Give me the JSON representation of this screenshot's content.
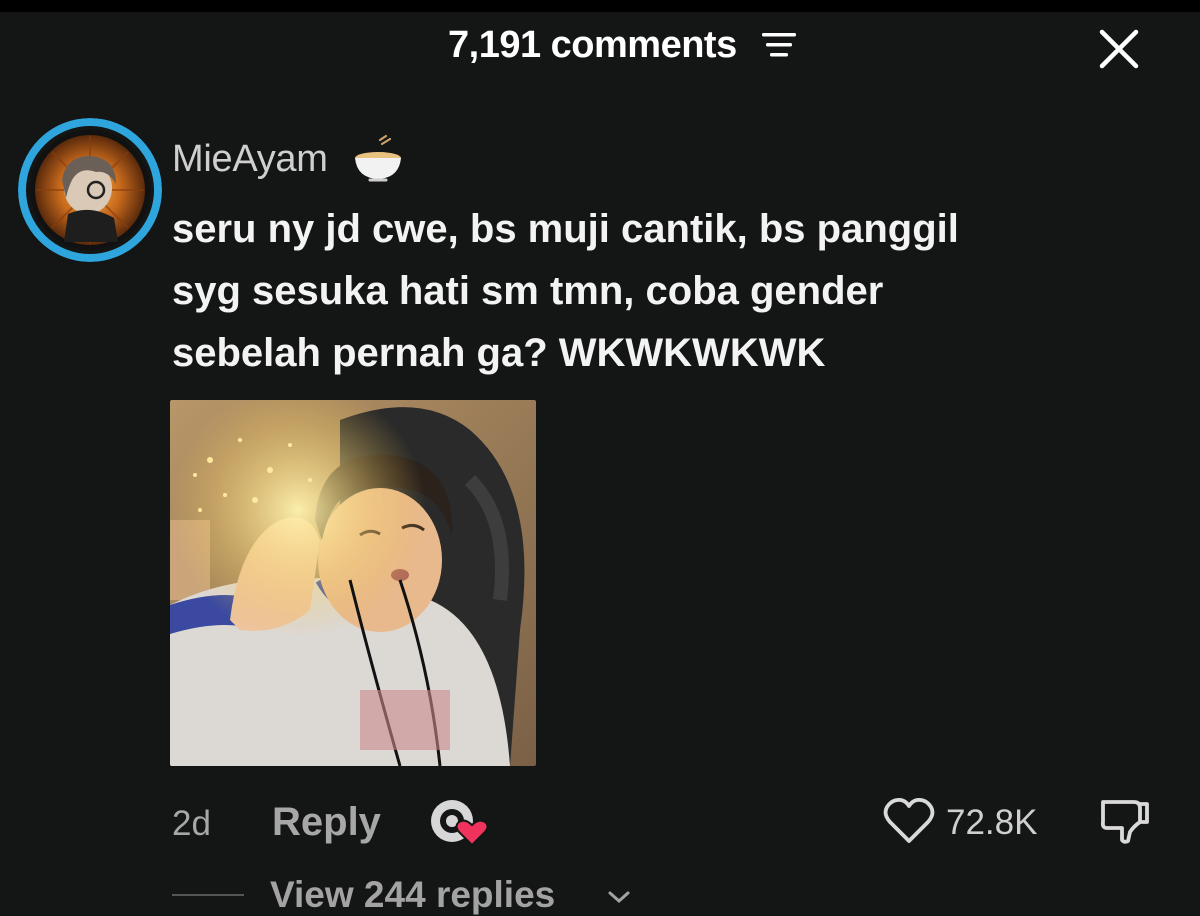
{
  "header": {
    "comment_count": "7,191 comments",
    "sort_icon": "sort-filter-icon",
    "close_icon": "close-icon"
  },
  "comment": {
    "username": "MieAyam",
    "username_emoji": "noodle-bowl-icon",
    "text_lines": [
      "seru ny jd cwe, bs muji cantik, bs panggil",
      "syg sesuka hati sm tmn, coba gender",
      "sebelah pernah ga? WKWKWKWK"
    ],
    "image_icon": "attached-photo",
    "age": "2d",
    "reply_label": "Reply",
    "gift_icon": "gift-heart-icon",
    "like_icon": "heart-outline-icon",
    "likes": "72.8K",
    "dislike_icon": "thumbs-down-icon",
    "view_replies": "View 244 replies"
  },
  "colors": {
    "background": "#141515",
    "avatar_ring": "#2ea5dc",
    "muted_text": "#a7a7a7",
    "gift_heart": "#f0335c"
  }
}
